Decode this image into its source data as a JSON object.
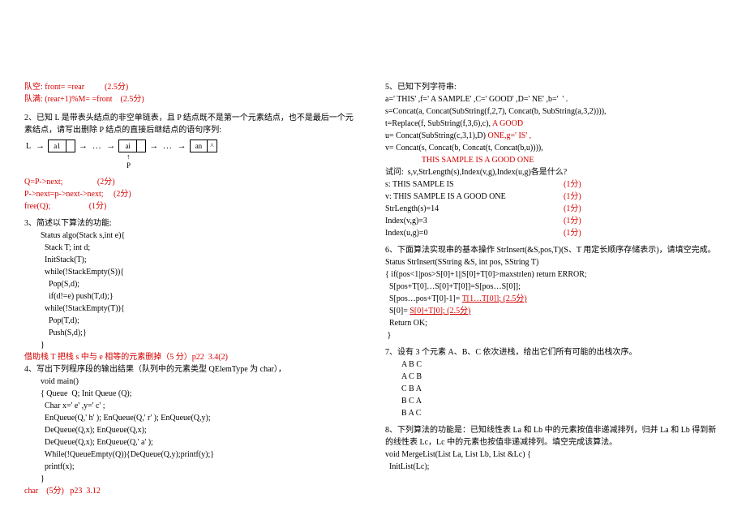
{
  "left": {
    "queue_empty": "队空: front= =rear          (2.5分)",
    "queue_full": "队满: (rear+1)%M= =front    (2.5分)",
    "q2_intro": "2、已知 L 是带表头结点的非空单链表，且 P 结点既不是第一个元素结点，也不是最后一个元素结点，请写出删除 P 结点的直接后继结点的语句序列:",
    "diagram": {
      "head": "L",
      "a1": "a1",
      "ai": "ai",
      "an": "an",
      "caret": "^",
      "dots": "...",
      "p_label": "P"
    },
    "q2_ans1": "Q=P->next;                 (2分)",
    "q2_ans2": "P->next=p->next->next;     (2分)",
    "q2_ans3": "free(Q);                   (1分)",
    "q3_title": "3、简述以下算法的功能:",
    "q3_code": [
      "Status algo(Stack s,int e){",
      "  Stack T; int d;",
      "  InitStack(T);",
      "  while(!StackEmpty(S)){",
      "    Pop(S,d);",
      "    if(d!=e) push(T,d);}",
      "  while(!StackEmpty(T)){",
      "    Pop(T,d);",
      "    Push(S,d);}",
      "}"
    ],
    "q3_ans": "借助栈 T 把栈 s 中与 e 相等的元素删掉（5 分）p22  3.4(2)",
    "q4_title": "4、写出下列程序段的输出结果（队列中的元素类型 QElemType 为 char），",
    "q4_code": [
      "void main()",
      "{ Queue  Q; Init Queue (Q);",
      "  Char x=' e' ,y=' c' ;",
      "  EnQueue(Q,' h' ); EnQueue(Q,' r' ); EnQueue(Q,y);",
      "  DeQueue(Q,x); EnQueue(Q,x);",
      "  DeQueue(Q,x); EnQueue(Q,' a' );",
      "  While(!QueueEmpty(Q)){DeQueue(Q,y);printf(y);}",
      "  printf(x);",
      "}"
    ],
    "q4_ans": "char    (5分)   p23  3.12"
  },
  "right": {
    "q5_title": "5、已知下列字符串:",
    "q5_lines": [
      "a=' THIS' ,f=' A SAMPLE' ,C=' GOOD' ,D=' NE' ,b='  ' .",
      "s=Concat(a, Concat(SubString(f,2,7), Concat(b, SubString(a,3,2)))),",
      "t=Replace(f, SubString(f,3,6),c),"
    ],
    "q5_red1": "A GOOD",
    "q5_lines2": [
      "u= Concat(SubString(c,3,1),D) ",
      "v= Concat(s, Concat(b, Concat(t, Concat(b,u)))),"
    ],
    "q5_red2_pref": "ONE,g=' IS' ,",
    "q5_red_big": "                  THIS SAMPLE IS A GOOD ONE",
    "q5_q": "试问:  s,v,StrLength(s),Index(v,g),Index(u,g)各是什么?",
    "q5_ans": [
      [
        "s: THIS SAMPLE IS",
        "(1分)"
      ],
      [
        "v: THIS SAMPLE IS A GOOD ONE",
        "(1分)"
      ],
      [
        "StrLength(s)=14",
        "(1分)"
      ],
      [
        "Index(v,g)=3",
        "(1分)"
      ],
      [
        "Index(u,g)=0",
        "(1分)"
      ]
    ],
    "q6_title": "6、下面算法实现串的基本操作 StrInsert(&S,pos,T)(S、T 用定长顺序存储表示)，请填空完成。",
    "q6_code1": [
      "Status StrInsert(SString &S, int pos, SString T)",
      "{ if(pos<1|pos>S[0]+1||S[0]+T[0]>maxstrlen) return ERROR;",
      "  S[pos+T[0]…S[0]+T[0]]=S[pos…S[0]];"
    ],
    "q6_red1_pre": "  S[pos…pos+T[0]-1]= ",
    "q6_red1": "T[1…T[0]]; (2.5分)",
    "q6_red2_pre": "  S[0]= ",
    "q6_red2": "S[0]+T[0]; (2.5分)",
    "q6_code2": [
      "  Return OK;",
      " }"
    ],
    "q7_title": "7、设有 3 个元素 A、B、C 依次进栈，给出它们所有可能的出栈次序。",
    "q7_list": [
      "A B C",
      "A C B",
      "C B A",
      "B C A",
      "B A C"
    ],
    "q8_title": "8、下列算法的功能是：已知线性表 La 和 Lb 中的元素按值非递减排列，归并 La 和 Lb 得到新的线性表 Lc，Lc 中的元素也按值非递减排列。填空完成该算法。",
    "q8_code": [
      "void MergeList(List La, List Lb, List &Lc) {",
      "  InitList(Lc);"
    ]
  }
}
